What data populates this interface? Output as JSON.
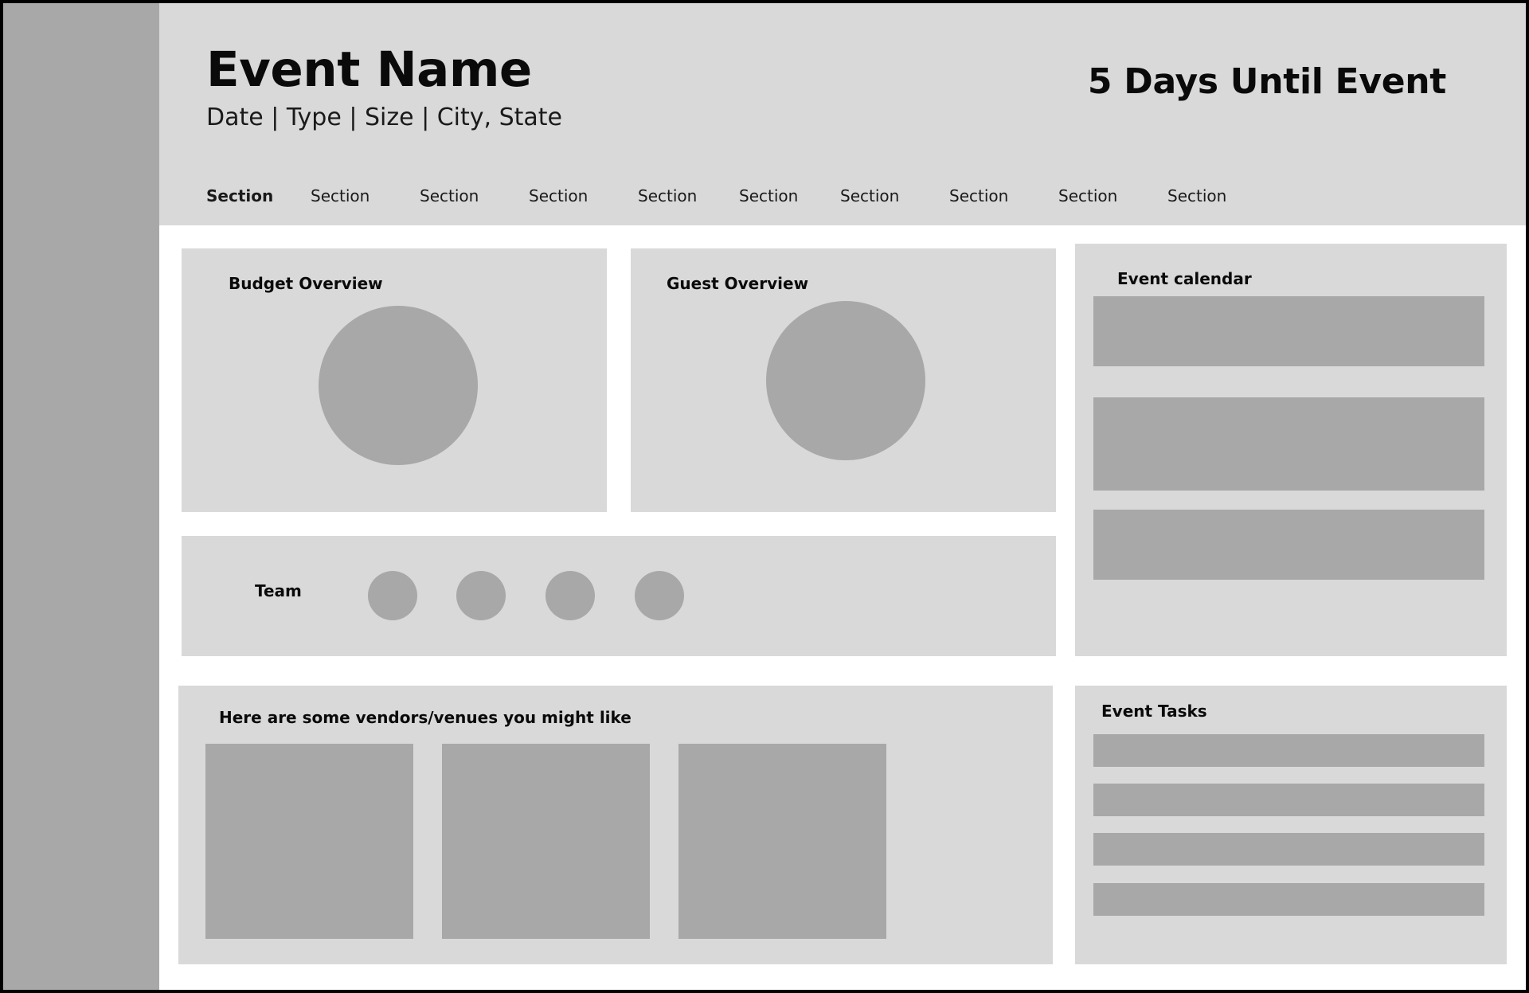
{
  "header": {
    "event_title": "Event Name",
    "event_meta": "Date | Type | Size | City, State",
    "countdown": "5 Days Until Event"
  },
  "nav": {
    "tabs": [
      "Section",
      "Section",
      "Section",
      "Section",
      "Section",
      "Section",
      "Section",
      "Section",
      "Section",
      "Section"
    ],
    "active_index": 0
  },
  "budget": {
    "title": "Budget Overview"
  },
  "guests": {
    "title": "Guest Overview"
  },
  "team": {
    "title": "Team"
  },
  "vendors": {
    "title": "Here are some vendors/venues you might like"
  },
  "calendar": {
    "title": "Event calendar"
  },
  "tasks": {
    "title": "Event Tasks"
  },
  "colors": {
    "frame": "#000000",
    "sidebar": "#a8a8a8",
    "panel": "#d9d9d9",
    "placeholder": "#a8a8a8",
    "content_bg": "#ffffff"
  }
}
